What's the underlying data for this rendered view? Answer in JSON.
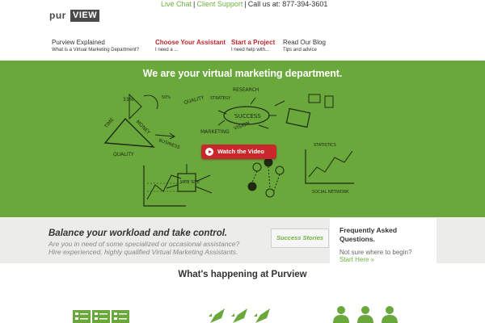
{
  "brand": {
    "logo_left": "pur",
    "logo_right": "VIEW"
  },
  "topbar": {
    "live_chat": "Live Chat",
    "separator": "|",
    "client_support": "Client Support",
    "call_us": "Call us at: 877-394-3601"
  },
  "nav": [
    {
      "title": "Purview Explained",
      "subtitle": "What is a Virtual Marketing Department?",
      "highlight": false
    },
    {
      "title": "Choose Your Assistant",
      "subtitle": "I need a ...",
      "highlight": true
    },
    {
      "title": "Start a Project",
      "subtitle": "I need help with...",
      "highlight": true
    },
    {
      "title": "Read Our Blog",
      "subtitle": "Tips and advice",
      "highlight": false
    }
  ],
  "hero": {
    "headline": "We are your virtual marketing department.",
    "watch_video": "Watch the Video",
    "sketch_words": [
      "RESEARCH",
      "QUALITY",
      "STRATEGY",
      "SUCCESS",
      "MARKETING",
      "VISION",
      "TIME",
      "MONEY",
      "QUALITY",
      "BUSINESS",
      "STATISTICS",
      "SOCIAL NETWORK",
      "WEB SITE",
      "33%",
      "50%"
    ]
  },
  "band": {
    "headline": "Balance your workload and take control.",
    "desc_line1": "Are you in need of some specialized or occasional assistance?",
    "desc_line2": "Hire experienced, highly qualified Virtual Marketing Assistants.",
    "success_button": "Success Stories"
  },
  "faq": {
    "title": "Frequently Asked Questions.",
    "question": "Not sure where to begin?",
    "link": "Start Here »"
  },
  "section": {
    "happening": "What's happening at Purview"
  },
  "icons": [
    "checklist-icon",
    "rocket-icon",
    "people-icon"
  ],
  "colors": {
    "green": "#6aa83c",
    "link_green": "#6fb03f",
    "red": "#c1272d",
    "button_red": "#c9272c",
    "band_gray": "#ececea"
  }
}
